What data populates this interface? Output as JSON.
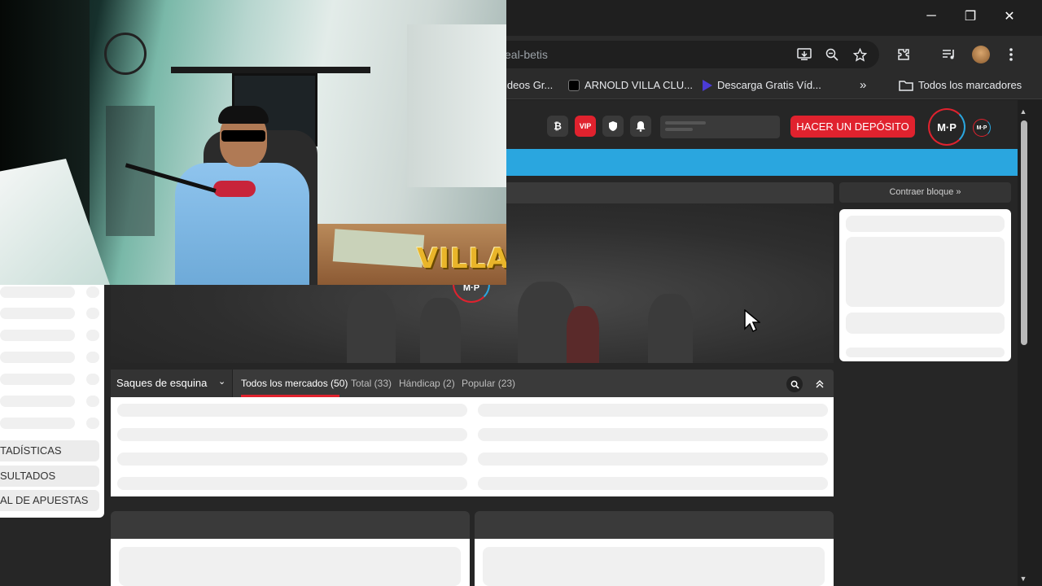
{
  "browser": {
    "url_fragment": "eal-betis",
    "window_controls": {
      "minimize": "─",
      "restore": "❐",
      "close": "✕"
    },
    "toolbar_icons": [
      "install-icon",
      "zoom-icon",
      "star-icon",
      "extensions-icon",
      "media-icon",
      "avatar",
      "menu-icon"
    ],
    "bookmarks": [
      {
        "label": "ideos Gr..."
      },
      {
        "label": "ARNOLD VILLA CLU..."
      },
      {
        "label": "Descarga Gratis Víd..."
      }
    ],
    "bookmarks_overflow": "»",
    "all_bookmarks": "Todos los marcadores"
  },
  "site": {
    "header_buttons": {
      "bitcoin": "₿",
      "vip": "VIP"
    },
    "deposit_label": "HACER UN DEPÓSITO",
    "logo_text": "M·P",
    "collapse_label": "Contraer bloque »"
  },
  "left_menu": {
    "items": [
      {
        "label": "TADÍSTICAS"
      },
      {
        "label": "SULTADOS"
      },
      {
        "label": "AL DE APUESTAS"
      }
    ]
  },
  "markets": {
    "selected": "Saques de esquina",
    "tabs": [
      {
        "label": "Todos los mercados (50)"
      },
      {
        "label": "Total (33)"
      },
      {
        "label": "Hándicap (2)"
      },
      {
        "label": "Popular (23)"
      }
    ]
  },
  "overlay": {
    "watermark": "VILLA"
  },
  "colors": {
    "accent_red": "#e0222e",
    "accent_blue": "#2aa6df",
    "page_bg": "#262626"
  }
}
